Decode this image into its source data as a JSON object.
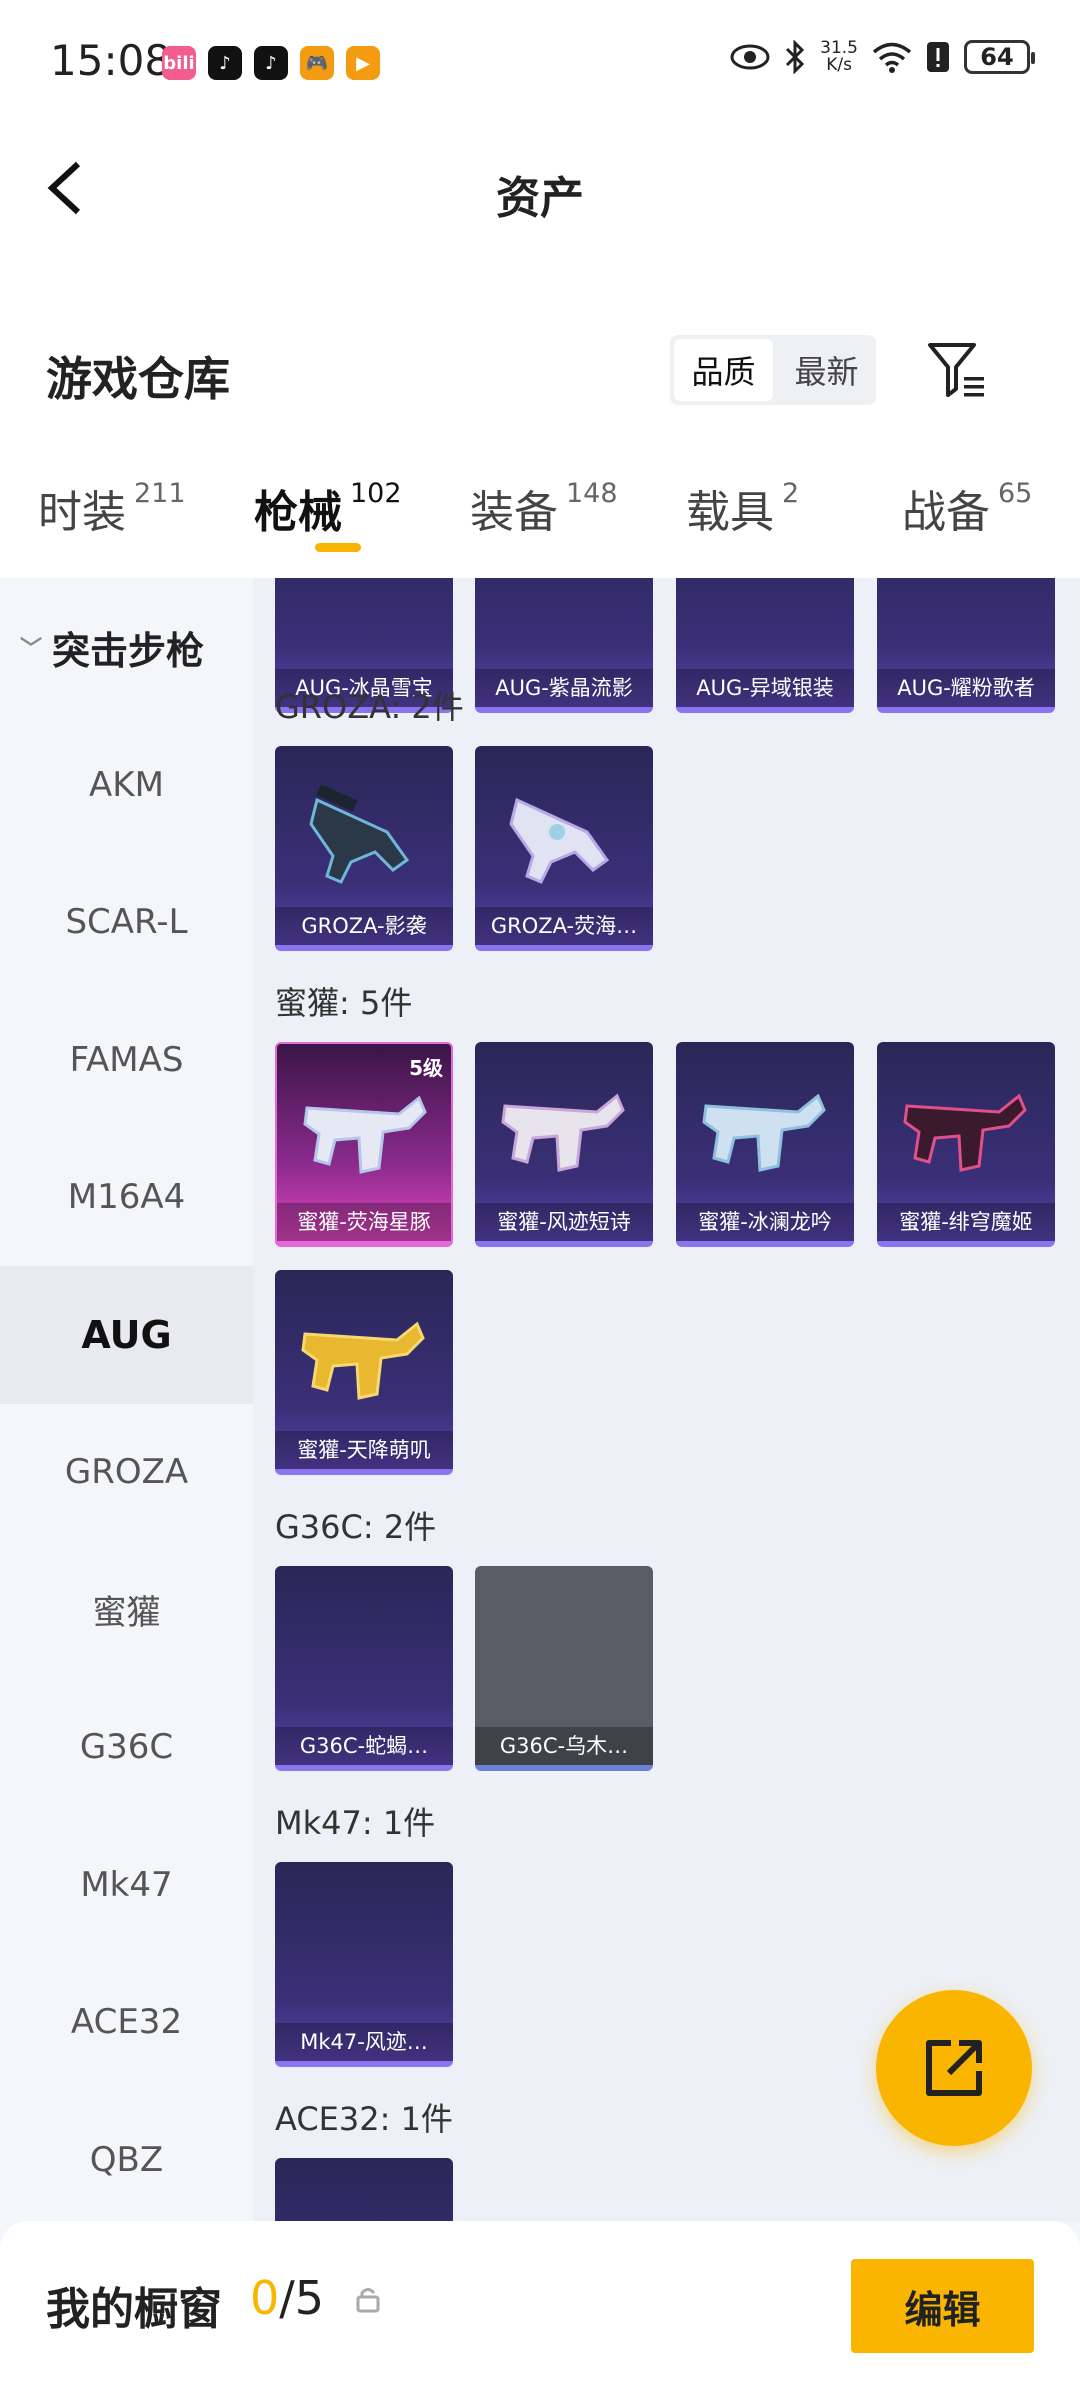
{
  "status_bar": {
    "time": "15:08",
    "apps": [
      {
        "icon": "bilibili-icon",
        "label": "bili",
        "color": "#f25d8e"
      },
      {
        "icon": "tiktok-icon",
        "label": "♪",
        "color": "#111111"
      },
      {
        "icon": "tiktok-icon",
        "label": "♪",
        "color": "#111111"
      },
      {
        "icon": "game-icon",
        "label": "🎮",
        "color": "#f39c12"
      },
      {
        "icon": "play-icon",
        "label": "▶",
        "color": "#f39c12"
      }
    ],
    "net_speed_value": "31.5",
    "net_speed_unit": "K/s",
    "battery": "64"
  },
  "header": {
    "title": "资产"
  },
  "warehouse": {
    "title": "游戏仓库",
    "sort_options": [
      "品质",
      "最新"
    ]
  },
  "tabs": [
    {
      "label": "时装",
      "count": "211"
    },
    {
      "label": "枪械",
      "count": "102"
    },
    {
      "label": "装备",
      "count": "148"
    },
    {
      "label": "载具",
      "count": "2"
    },
    {
      "label": "战备",
      "count": "65"
    }
  ],
  "sidebar": {
    "group": "突击步枪",
    "items": [
      "AKM",
      "SCAR-L",
      "FAMAS",
      "M16A4",
      "AUG",
      "GROZA",
      "蜜獾",
      "G36C",
      "Mk47",
      "ACE32",
      "QBZ"
    ],
    "active": "AUG"
  },
  "content": {
    "aug_cards": [
      "AUG-冰晶雪宝",
      "AUG-紫晶流影",
      "AUG-异域银装",
      "AUG-耀粉歌者"
    ],
    "groups": [
      {
        "title": "GROZA: 2件",
        "cards": [
          "GROZA-影袭",
          "GROZA-荧海…"
        ]
      },
      {
        "title": "蜜獾: 5件",
        "cards": [
          "蜜獾-荧海星豚",
          "蜜獾-风迹短诗",
          "蜜獾-冰澜龙吟",
          "蜜獾-绯穹魔姬",
          "蜜獾-天降萌叽"
        ],
        "level": "5级"
      },
      {
        "title": "G36C: 2件",
        "cards": [
          "G36C-蛇蝎…",
          "G36C-乌木…"
        ]
      },
      {
        "title": "Mk47: 1件",
        "cards": [
          "Mk47-风迹…"
        ]
      },
      {
        "title": "ACE32: 1件",
        "cards": []
      }
    ]
  },
  "bottom": {
    "title": "我的橱窗",
    "current": "0",
    "total": "/5",
    "edit_label": "编辑"
  },
  "colors": {
    "accent": "#f9b500",
    "card_purple": "#3b2f78",
    "card_pink": "#e046c0"
  }
}
